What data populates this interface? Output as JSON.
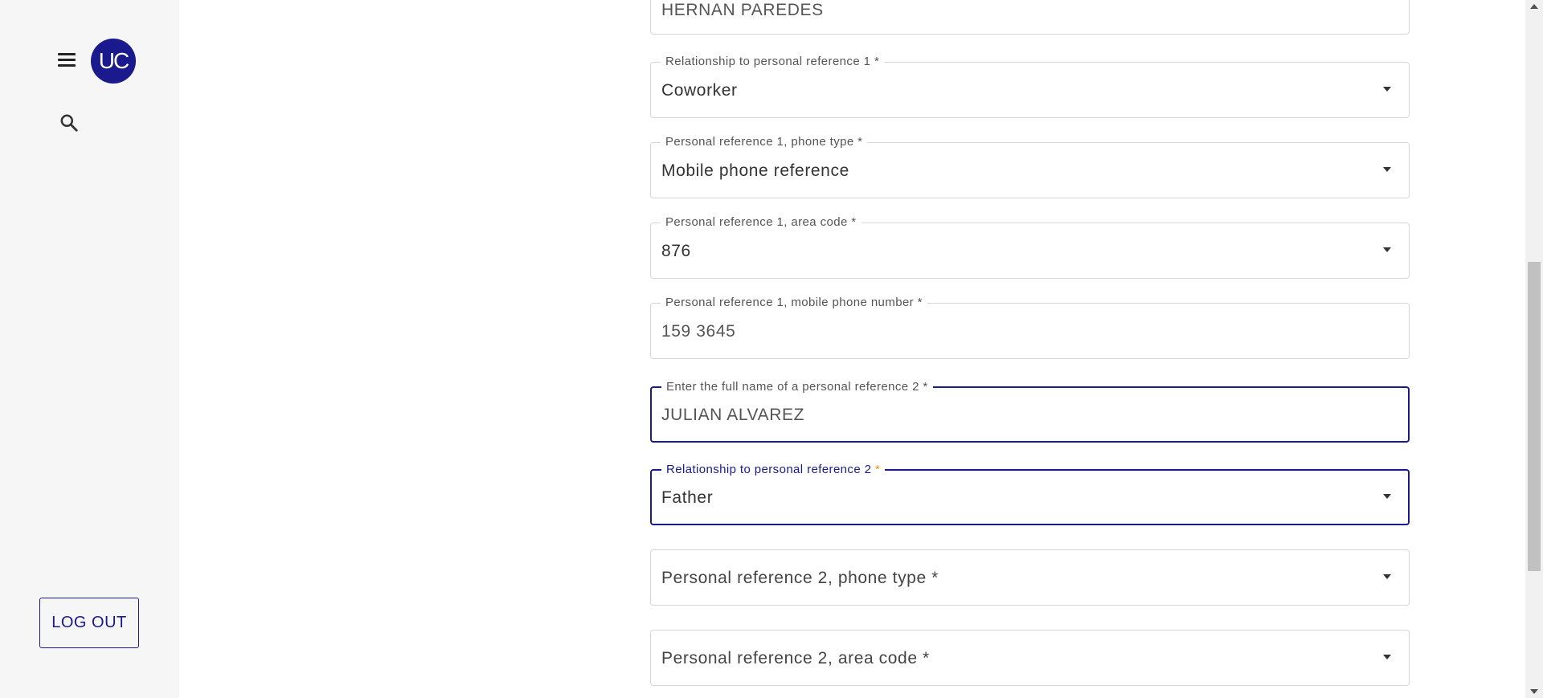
{
  "sidebar": {
    "avatar_initials": "UC",
    "logout_label": "LOG OUT"
  },
  "colors": {
    "accent": "#1a1a8e",
    "required_focused": "#e8921c"
  },
  "form": {
    "ref1_name_value": "HERNAN PAREDES",
    "ref1_relationship": {
      "label": "Relationship to personal reference 1 *",
      "value": "Coworker"
    },
    "ref1_phone_type": {
      "label": "Personal reference 1, phone type *",
      "value": "Mobile phone reference"
    },
    "ref1_area_code": {
      "label": "Personal reference 1, area code *",
      "value": "876"
    },
    "ref1_mobile_number": {
      "label": "Personal reference 1, mobile phone number *",
      "value": "159 3645"
    },
    "ref2_name": {
      "label": "Enter the full name of a personal reference 2 *",
      "value": "JULIAN ALVAREZ"
    },
    "ref2_relationship": {
      "label": "Relationship to personal reference 2",
      "star": "*",
      "value": "Father"
    },
    "ref2_phone_type": {
      "placeholder": "Personal reference 2, phone type *"
    },
    "ref2_area_code": {
      "placeholder": "Personal reference 2, area code *"
    }
  }
}
